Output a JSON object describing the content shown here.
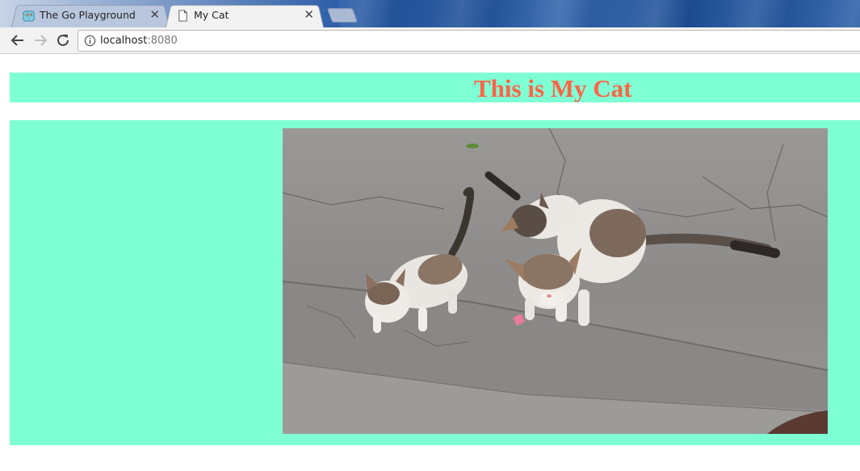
{
  "tabs": [
    {
      "title": "The Go Playground",
      "icon": "gopher-icon",
      "active": false
    },
    {
      "title": "My Cat",
      "icon": "page-icon",
      "active": true
    }
  ],
  "address_bar": {
    "host": "localhost",
    "port": ":8080",
    "icon": "info-icon"
  },
  "page": {
    "heading": "This is My Cat",
    "heading_color": "#ff6347",
    "background_color": "#7fffd4",
    "image": {
      "subject": "three kittens"
    }
  },
  "colors": {
    "accent": "#7fffd4",
    "heading": "#ff6347"
  }
}
